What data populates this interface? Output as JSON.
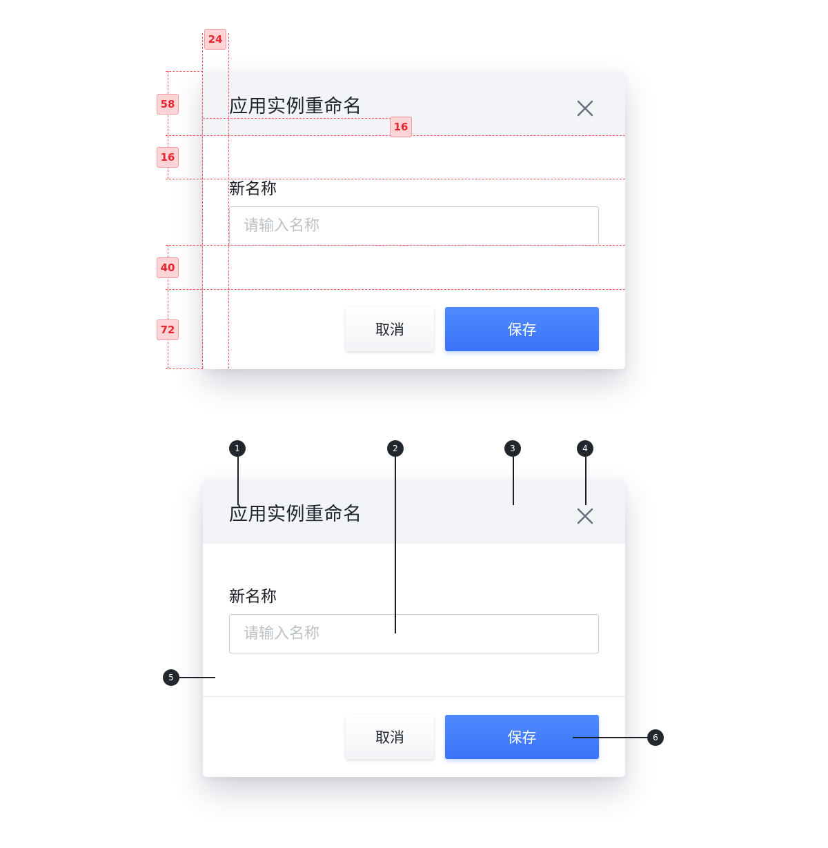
{
  "dialog": {
    "title": "应用实例重命名",
    "field_label": "新名称",
    "input_placeholder": "请输入名称",
    "input_value": "",
    "cancel_label": "取消",
    "save_label": "保存",
    "close_icon": "close-icon"
  },
  "spacing_annotations": {
    "padding_left": "24",
    "header_height": "58",
    "header_to_label": "16",
    "label_to_input": "16",
    "content_to_footer": "40",
    "footer_height": "72"
  },
  "callouts": [
    "1",
    "2",
    "3",
    "4",
    "5",
    "6"
  ],
  "colors": {
    "header_bg": "#f2f4f8",
    "primary": "#3d78f8",
    "annotation": "#e62530",
    "callout": "#22262d"
  }
}
